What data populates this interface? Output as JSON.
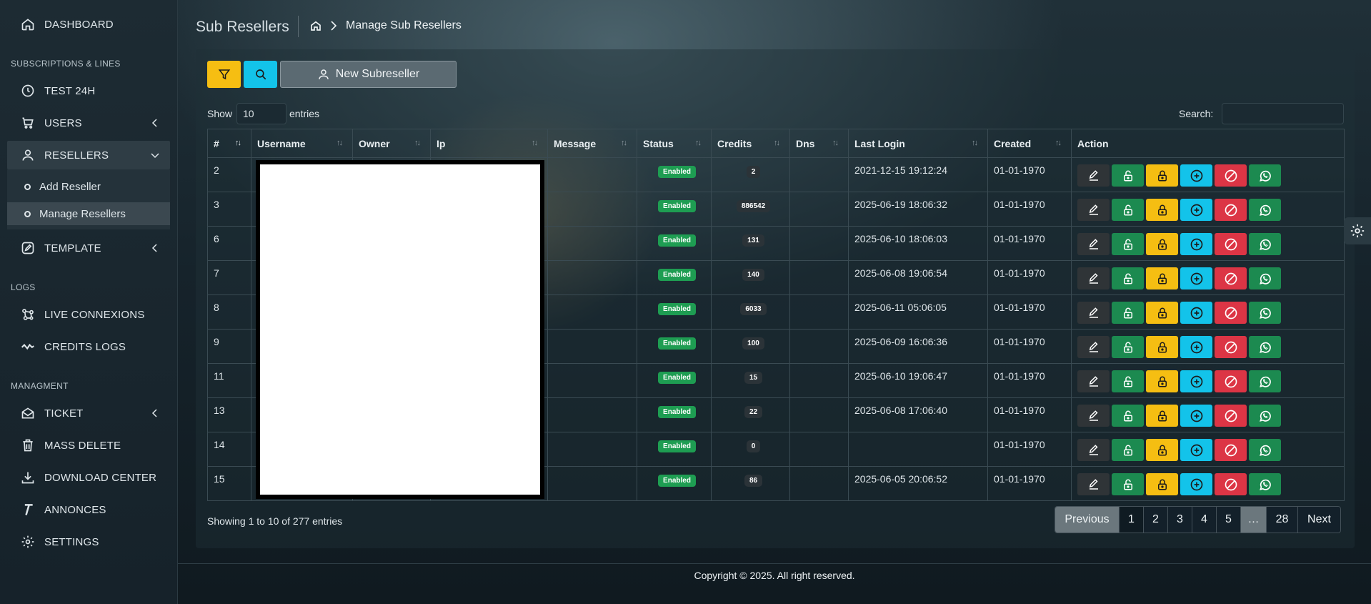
{
  "sidebar": {
    "dashboard": "DASHBOARD",
    "section_subscriptions": "SUBSCRIPTIONS & LINES",
    "test24h": "TEST 24H",
    "users": "USERS",
    "resellers": "RESELLERS",
    "add_reseller": "Add Reseller",
    "manage_resellers": "Manage Resellers",
    "template": "TEMPLATE",
    "section_logs": "LOGS",
    "live_connexions": "LIVE CONNEXIONS",
    "credits_logs": "CREDITS LOGS",
    "section_managment": "MANAGMENT",
    "ticket": "TICKET",
    "mass_delete": "MASS DELETE",
    "download_center": "DOWNLOAD CENTER",
    "annonces": "ANNONCES",
    "settings": "SETTINGS"
  },
  "header": {
    "title": "Sub Resellers",
    "breadcrumb_current": "Manage Sub Resellers"
  },
  "toolbar": {
    "new_subreseller": "New Subreseller"
  },
  "table_controls": {
    "show": "Show",
    "page_length": "10",
    "entries": "entries",
    "search": "Search:"
  },
  "columns": [
    "#",
    "Username",
    "Owner",
    "Ip",
    "Message",
    "Status",
    "Credits",
    "Dns",
    "Last Login",
    "Created",
    "Action"
  ],
  "rows": [
    {
      "id": "2",
      "status": "Enabled",
      "credits": "2",
      "last_login": "2021-12-15 19:12:24",
      "created": "01-01-1970"
    },
    {
      "id": "3",
      "status": "Enabled",
      "credits": "886542",
      "last_login": "2025-06-19 18:06:32",
      "created": "01-01-1970"
    },
    {
      "id": "6",
      "status": "Enabled",
      "credits": "131",
      "last_login": "2025-06-10 18:06:03",
      "created": "01-01-1970"
    },
    {
      "id": "7",
      "status": "Enabled",
      "credits": "140",
      "last_login": "2025-06-08 19:06:54",
      "created": "01-01-1970"
    },
    {
      "id": "8",
      "status": "Enabled",
      "credits": "6033",
      "last_login": "2025-06-11 05:06:05",
      "created": "01-01-1970"
    },
    {
      "id": "9",
      "status": "Enabled",
      "credits": "100",
      "last_login": "2025-06-09 16:06:36",
      "created": "01-01-1970"
    },
    {
      "id": "11",
      "status": "Enabled",
      "credits": "15",
      "last_login": "2025-06-10 19:06:47",
      "created": "01-01-1970"
    },
    {
      "id": "13",
      "status": "Enabled",
      "credits": "22",
      "last_login": "2025-06-08 17:06:40",
      "created": "01-01-1970"
    },
    {
      "id": "14",
      "status": "Enabled",
      "credits": "0",
      "last_login": "",
      "created": "01-01-1970"
    },
    {
      "id": "15",
      "status": "Enabled",
      "credits": "86",
      "last_login": "2025-06-05 20:06:52",
      "created": "01-01-1970"
    }
  ],
  "footer_info": "Showing 1 to 10 of 277 entries",
  "pagination": {
    "previous": "Previous",
    "pages": [
      "1",
      "2",
      "3",
      "4",
      "5"
    ],
    "ellipsis": "…",
    "last": "28",
    "next": "Next"
  },
  "copyright": "Copyright © 2025. All right reserved.",
  "colors": {
    "warning": "#f6be12",
    "info": "#13c3ea",
    "success": "#1c8a50",
    "danger": "#dc3545"
  }
}
